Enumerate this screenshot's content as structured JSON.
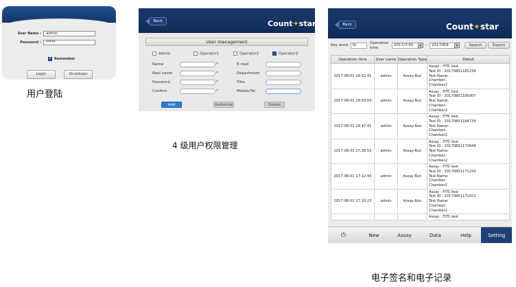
{
  "login": {
    "username_label": "User Name :",
    "username_value": "admin",
    "password_label": "Password :",
    "password_value": "*****",
    "remember_label": "Remember",
    "login_button": "Login",
    "shutdown_button": "Shutdown",
    "caption": "用户登陆"
  },
  "user_management": {
    "back_label": "Back",
    "logo_left": "Count",
    "logo_right": "star",
    "title": "User management",
    "roles": [
      "Admin",
      "Operator1",
      "Operator2",
      "Operator3"
    ],
    "selected_role": "Operator3",
    "fields_left": [
      "Name",
      "Real name",
      "Password",
      "Confirm"
    ],
    "fields_right": [
      "E-mail",
      "Department",
      "Title",
      "Mobile/Tel"
    ],
    "required_mark": "*",
    "buttons": {
      "add": "Add",
      "authorize": "Authorize",
      "delete": "Delete"
    },
    "caption": "4 级用户权限管理"
  },
  "audit_log": {
    "back_label": "Back",
    "logo_left": "Count",
    "logo_right": "star",
    "keyword_label": "Key word",
    "keyword_value": "Ki",
    "operation_time_label_1": "Operation",
    "operation_time_label_2": "time",
    "date_from": "2017/7/30",
    "date_separator": "-",
    "date_to": "2017/8/9",
    "search_button": "Search",
    "export_button": "Export",
    "columns": [
      "Operation time",
      "User name",
      "Operation Type",
      "Detail"
    ],
    "rows": [
      {
        "time": "2017-08-01 18:52:41",
        "user": "admin",
        "type": "Assay-Run",
        "detail": "Assay : FITC-test\nTest ID : 20170801185239\nTest Name:\nChamber:\nChamber2"
      },
      {
        "time": "2017-08-01 18:50:09",
        "user": "admin",
        "type": "Assay-Run",
        "detail": "Assay : FITC-test\nTest ID : 20170801185007\nTest Name:\nChamber:\nChamber2"
      },
      {
        "time": "2017-08-01 18:47:41",
        "user": "admin",
        "type": "Assay-Run",
        "detail": "Assay : FITC-test\nTest ID : 20170801184739\nTest Name:\nChamber:\nChamber2"
      },
      {
        "time": "2017-08-01 17:36:52",
        "user": "admin",
        "type": "Assay-Run",
        "detail": "Assay : FITC-test\nTest ID : 20170801173649\nTest Name:\nChamber:\nChamber2"
      },
      {
        "time": "2017-08-01 17:12:45",
        "user": "admin",
        "type": "Assay-Run",
        "detail": "Assay : FITC-test\nTest ID : 20170801171243\nTest Name:\nChamber:\nChamber2"
      },
      {
        "time": "2017-08-01 17:10:23",
        "user": "admin",
        "type": "Assay-Run",
        "detail": "Assay : FITC-test\nTest ID : 20170801171021\nTest Name:\nChamber:\nChamber2"
      },
      {
        "time": "",
        "user": "",
        "type": "",
        "detail": "Assay : FITC-test"
      }
    ],
    "tabs": [
      "New",
      "Assay",
      "Data",
      "Help",
      "Setting"
    ],
    "active_tab": "Setting",
    "power_icon": "power-icon",
    "caption": "电子签名和电子记录"
  },
  "colors": {
    "brand_dark": "#14386a",
    "accent": "#f5a623",
    "active_tab": "#1f3f75",
    "add_button": "#2a7fd4"
  }
}
